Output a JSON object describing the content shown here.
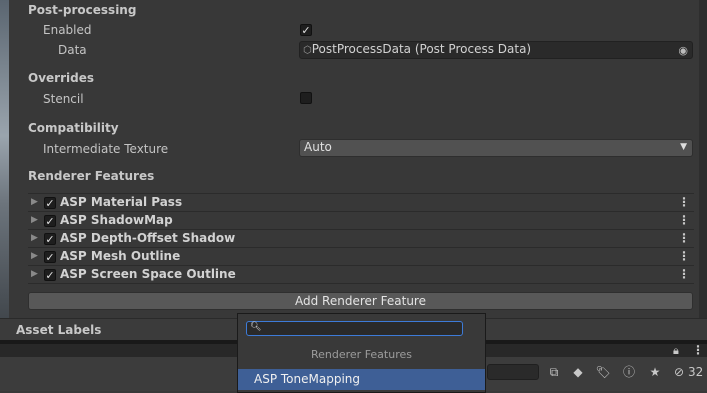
{
  "post_processing": {
    "heading": "Post-processing",
    "enabled_label": "Enabled",
    "enabled_check": "✓",
    "data_label": "Data",
    "data_value": "PostProcessData (Post Process Data)"
  },
  "overrides": {
    "heading": "Overrides",
    "stencil_label": "Stencil"
  },
  "compatibility": {
    "heading": "Compatibility",
    "intermediate_label": "Intermediate Texture",
    "intermediate_value": "Auto"
  },
  "renderer_features": {
    "heading": "Renderer Features",
    "items": [
      {
        "name": "ASP Material Pass",
        "check": "✓"
      },
      {
        "name": "ASP ShadowMap",
        "check": "✓"
      },
      {
        "name": "ASP Depth-Offset Shadow",
        "check": "✓"
      },
      {
        "name": "ASP Mesh Outline",
        "check": "✓"
      },
      {
        "name": "ASP Screen Space Outline",
        "check": "✓"
      }
    ],
    "add_button": "Add Renderer Feature"
  },
  "asset_labels": {
    "heading": "Asset Labels"
  },
  "popup": {
    "search_value": "",
    "header": "Renderer Features",
    "item": "ASP ToneMapping"
  },
  "toolbar": {
    "hidden_count": "32"
  }
}
